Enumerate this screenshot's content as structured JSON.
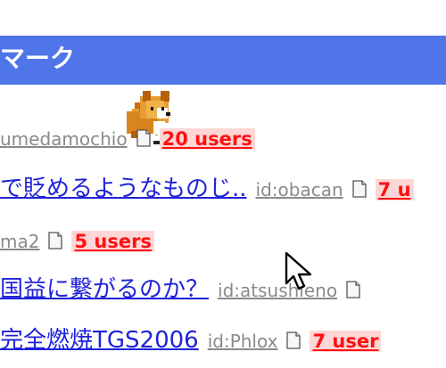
{
  "header": {
    "title": "マーク",
    "bar_color": "#4f75e8"
  },
  "mascot": {
    "name": "corgi-mascot"
  },
  "rows": [
    {
      "user": "umedamochio",
      "users": "20 users",
      "icon": "document-icon"
    },
    {
      "title": "で貶めるようなものじ..",
      "user": "id:obacan",
      "users": "7 u",
      "icon": "document-icon"
    },
    {
      "user": "ma2",
      "users": "5 users",
      "icon": "document-icon"
    },
    {
      "title": "国益に繋がるのか？",
      "user": "id:atsushieno",
      "icon": "document-icon"
    },
    {
      "title": "完全燃焼TGS2006",
      "user": "id:Phlox",
      "users": "7 user",
      "icon": "document-icon"
    }
  ],
  "cursor": {
    "icon": "mouse-pointer-icon"
  }
}
